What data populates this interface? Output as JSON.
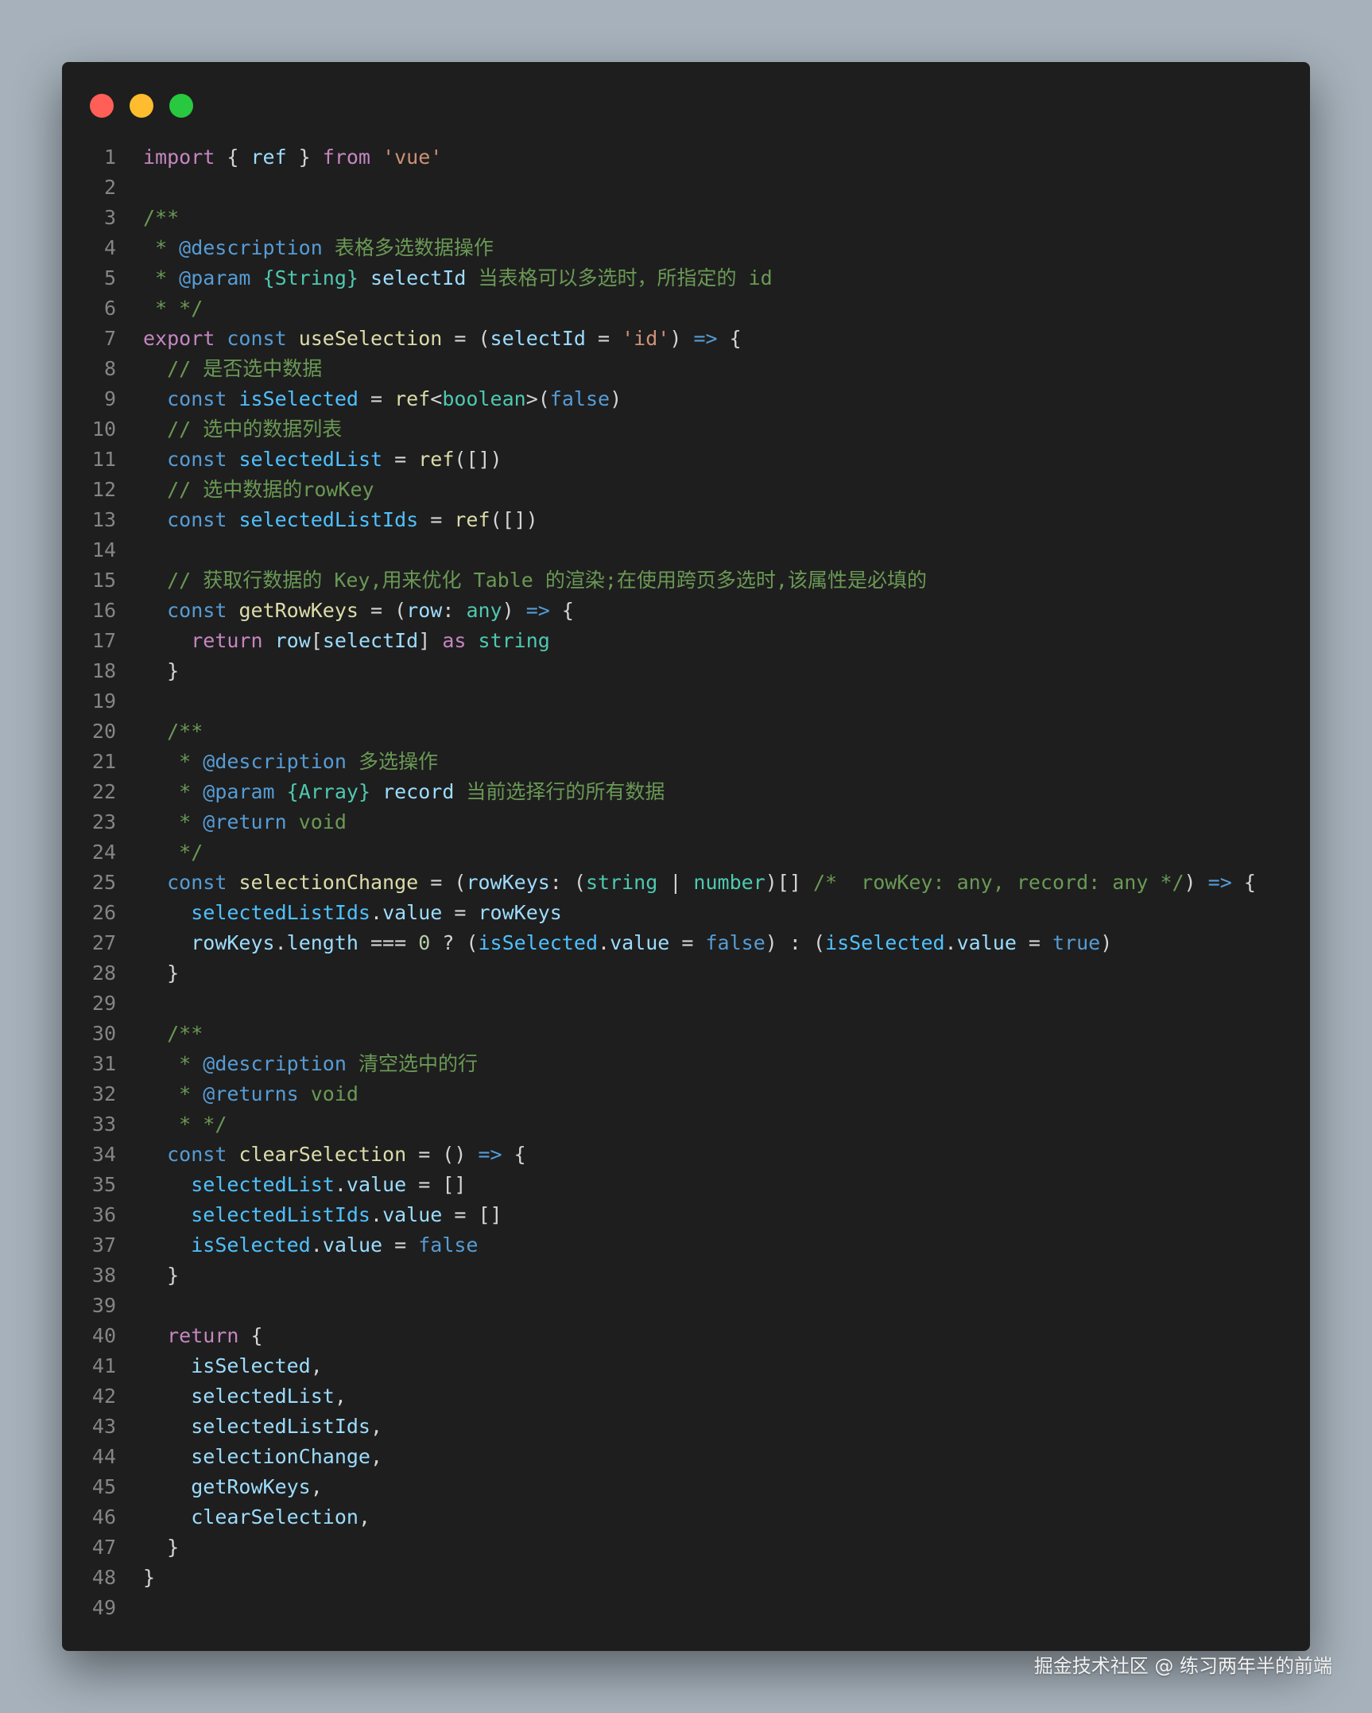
{
  "window": {
    "dots": [
      {
        "name": "close",
        "color": "#ff5f57"
      },
      {
        "name": "minimize",
        "color": "#febc2e"
      },
      {
        "name": "maximize",
        "color": "#28c840"
      }
    ]
  },
  "colors": {
    "page_background": "#a6b1bb",
    "editor_background": "#1e1e1e",
    "line_number": "#858585"
  },
  "code": {
    "language": "typescript",
    "lines": [
      [
        [
          "kw",
          "import"
        ],
        [
          "pn",
          " { "
        ],
        [
          "id",
          "ref"
        ],
        [
          "pn",
          " } "
        ],
        [
          "kw",
          "from"
        ],
        [
          "pn",
          " "
        ],
        [
          "st",
          "'vue'"
        ]
      ],
      [],
      [
        [
          "cm",
          "/**"
        ]
      ],
      [
        [
          "cm",
          " * "
        ],
        [
          "k2",
          "@description"
        ],
        [
          "cm",
          " 表格多选数据操作"
        ]
      ],
      [
        [
          "cm",
          " * "
        ],
        [
          "k2",
          "@param"
        ],
        [
          "cm",
          " "
        ],
        [
          "ty",
          "{String}"
        ],
        [
          "cm",
          " "
        ],
        [
          "id",
          "selectId"
        ],
        [
          "cm",
          " 当表格可以多选时，所指定的 id"
        ]
      ],
      [
        [
          "cm",
          " * */"
        ]
      ],
      [
        [
          "kw",
          "export"
        ],
        [
          "pn",
          " "
        ],
        [
          "k2",
          "const"
        ],
        [
          "pn",
          " "
        ],
        [
          "fn",
          "useSelection"
        ],
        [
          "pn",
          " = ("
        ],
        [
          "id",
          "selectId"
        ],
        [
          "pn",
          " = "
        ],
        [
          "st",
          "'id'"
        ],
        [
          "pn",
          ") "
        ],
        [
          "k2",
          "=>"
        ],
        [
          "pn",
          " {"
        ]
      ],
      [
        [
          "pn",
          "  "
        ],
        [
          "cm",
          "// 是否选中数据"
        ]
      ],
      [
        [
          "pn",
          "  "
        ],
        [
          "k2",
          "const"
        ],
        [
          "pn",
          " "
        ],
        [
          "cn",
          "isSelected"
        ],
        [
          "pn",
          " = "
        ],
        [
          "fn",
          "ref"
        ],
        [
          "pn",
          "<"
        ],
        [
          "ty",
          "boolean"
        ],
        [
          "pn",
          ">("
        ],
        [
          "k2",
          "false"
        ],
        [
          "pn",
          ")"
        ]
      ],
      [
        [
          "pn",
          "  "
        ],
        [
          "cm",
          "// 选中的数据列表"
        ]
      ],
      [
        [
          "pn",
          "  "
        ],
        [
          "k2",
          "const"
        ],
        [
          "pn",
          " "
        ],
        [
          "cn",
          "selectedList"
        ],
        [
          "pn",
          " = "
        ],
        [
          "fn",
          "ref"
        ],
        [
          "pn",
          "([])"
        ]
      ],
      [
        [
          "pn",
          "  "
        ],
        [
          "cm",
          "// 选中数据的rowKey"
        ]
      ],
      [
        [
          "pn",
          "  "
        ],
        [
          "k2",
          "const"
        ],
        [
          "pn",
          " "
        ],
        [
          "cn",
          "selectedListIds"
        ],
        [
          "pn",
          " = "
        ],
        [
          "fn",
          "ref"
        ],
        [
          "pn",
          "([])"
        ]
      ],
      [],
      [
        [
          "pn",
          "  "
        ],
        [
          "cm",
          "// 获取行数据的 Key,用来优化 Table 的渲染;在使用跨页多选时,该属性是必填的"
        ]
      ],
      [
        [
          "pn",
          "  "
        ],
        [
          "k2",
          "const"
        ],
        [
          "pn",
          " "
        ],
        [
          "fn",
          "getRowKeys"
        ],
        [
          "pn",
          " = ("
        ],
        [
          "id",
          "row"
        ],
        [
          "pn",
          ": "
        ],
        [
          "ty",
          "any"
        ],
        [
          "pn",
          ") "
        ],
        [
          "k2",
          "=>"
        ],
        [
          "pn",
          " {"
        ]
      ],
      [
        [
          "pn",
          "    "
        ],
        [
          "kw",
          "return"
        ],
        [
          "pn",
          " "
        ],
        [
          "id",
          "row"
        ],
        [
          "pn",
          "["
        ],
        [
          "id",
          "selectId"
        ],
        [
          "pn",
          "] "
        ],
        [
          "kw",
          "as"
        ],
        [
          "pn",
          " "
        ],
        [
          "ty",
          "string"
        ]
      ],
      [
        [
          "pn",
          "  }"
        ]
      ],
      [],
      [
        [
          "pn",
          "  "
        ],
        [
          "cm",
          "/**"
        ]
      ],
      [
        [
          "pn",
          "  "
        ],
        [
          "cm",
          " * "
        ],
        [
          "k2",
          "@description"
        ],
        [
          "cm",
          " 多选操作"
        ]
      ],
      [
        [
          "pn",
          "  "
        ],
        [
          "cm",
          " * "
        ],
        [
          "k2",
          "@param"
        ],
        [
          "cm",
          " "
        ],
        [
          "ty",
          "{Array}"
        ],
        [
          "cm",
          " "
        ],
        [
          "id",
          "record"
        ],
        [
          "cm",
          " 当前选择行的所有数据"
        ]
      ],
      [
        [
          "pn",
          "  "
        ],
        [
          "cm",
          " * "
        ],
        [
          "k2",
          "@return"
        ],
        [
          "cm",
          " void"
        ]
      ],
      [
        [
          "pn",
          "  "
        ],
        [
          "cm",
          " */"
        ]
      ],
      [
        [
          "pn",
          "  "
        ],
        [
          "k2",
          "const"
        ],
        [
          "pn",
          " "
        ],
        [
          "fn",
          "selectionChange"
        ],
        [
          "pn",
          " = ("
        ],
        [
          "id",
          "rowKeys"
        ],
        [
          "pn",
          ": ("
        ],
        [
          "ty",
          "string"
        ],
        [
          "pn",
          " | "
        ],
        [
          "ty",
          "number"
        ],
        [
          "pn",
          ")[] "
        ],
        [
          "cm",
          "/*  rowKey: any, record: any */"
        ],
        [
          "pn",
          ") "
        ],
        [
          "k2",
          "=>"
        ],
        [
          "pn",
          " {"
        ]
      ],
      [
        [
          "pn",
          "    "
        ],
        [
          "cn",
          "selectedListIds"
        ],
        [
          "pn",
          "."
        ],
        [
          "id",
          "value"
        ],
        [
          "pn",
          " = "
        ],
        [
          "id",
          "rowKeys"
        ]
      ],
      [
        [
          "pn",
          "    "
        ],
        [
          "id",
          "rowKeys"
        ],
        [
          "pn",
          "."
        ],
        [
          "id",
          "length"
        ],
        [
          "pn",
          " === "
        ],
        [
          "num",
          "0"
        ],
        [
          "pn",
          " ? ("
        ],
        [
          "cn",
          "isSelected"
        ],
        [
          "pn",
          "."
        ],
        [
          "id",
          "value"
        ],
        [
          "pn",
          " = "
        ],
        [
          "k2",
          "false"
        ],
        [
          "pn",
          ") : ("
        ],
        [
          "cn",
          "isSelected"
        ],
        [
          "pn",
          "."
        ],
        [
          "id",
          "value"
        ],
        [
          "pn",
          " = "
        ],
        [
          "k2",
          "true"
        ],
        [
          "pn",
          ")"
        ]
      ],
      [
        [
          "pn",
          "  }"
        ]
      ],
      [],
      [
        [
          "pn",
          "  "
        ],
        [
          "cm",
          "/**"
        ]
      ],
      [
        [
          "pn",
          "  "
        ],
        [
          "cm",
          " * "
        ],
        [
          "k2",
          "@description"
        ],
        [
          "cm",
          " 清空选中的行"
        ]
      ],
      [
        [
          "pn",
          "  "
        ],
        [
          "cm",
          " * "
        ],
        [
          "k2",
          "@returns"
        ],
        [
          "cm",
          " void"
        ]
      ],
      [
        [
          "pn",
          "  "
        ],
        [
          "cm",
          " * */"
        ]
      ],
      [
        [
          "pn",
          "  "
        ],
        [
          "k2",
          "const"
        ],
        [
          "pn",
          " "
        ],
        [
          "fn",
          "clearSelection"
        ],
        [
          "pn",
          " = () "
        ],
        [
          "k2",
          "=>"
        ],
        [
          "pn",
          " {"
        ]
      ],
      [
        [
          "pn",
          "    "
        ],
        [
          "cn",
          "selectedList"
        ],
        [
          "pn",
          "."
        ],
        [
          "id",
          "value"
        ],
        [
          "pn",
          " = []"
        ]
      ],
      [
        [
          "pn",
          "    "
        ],
        [
          "cn",
          "selectedListIds"
        ],
        [
          "pn",
          "."
        ],
        [
          "id",
          "value"
        ],
        [
          "pn",
          " = []"
        ]
      ],
      [
        [
          "pn",
          "    "
        ],
        [
          "cn",
          "isSelected"
        ],
        [
          "pn",
          "."
        ],
        [
          "id",
          "value"
        ],
        [
          "pn",
          " = "
        ],
        [
          "k2",
          "false"
        ]
      ],
      [
        [
          "pn",
          "  }"
        ]
      ],
      [],
      [
        [
          "pn",
          "  "
        ],
        [
          "kw",
          "return"
        ],
        [
          "pn",
          " {"
        ]
      ],
      [
        [
          "pn",
          "    "
        ],
        [
          "id",
          "isSelected"
        ],
        [
          "pn",
          ","
        ]
      ],
      [
        [
          "pn",
          "    "
        ],
        [
          "id",
          "selectedList"
        ],
        [
          "pn",
          ","
        ]
      ],
      [
        [
          "pn",
          "    "
        ],
        [
          "id",
          "selectedListIds"
        ],
        [
          "pn",
          ","
        ]
      ],
      [
        [
          "pn",
          "    "
        ],
        [
          "id",
          "selectionChange"
        ],
        [
          "pn",
          ","
        ]
      ],
      [
        [
          "pn",
          "    "
        ],
        [
          "id",
          "getRowKeys"
        ],
        [
          "pn",
          ","
        ]
      ],
      [
        [
          "pn",
          "    "
        ],
        [
          "id",
          "clearSelection"
        ],
        [
          "pn",
          ","
        ]
      ],
      [
        [
          "pn",
          "  }"
        ]
      ],
      [
        [
          "pn",
          "}"
        ]
      ],
      []
    ]
  },
  "watermark": {
    "text": "掘金技术社区 @ 练习两年半的前端"
  }
}
